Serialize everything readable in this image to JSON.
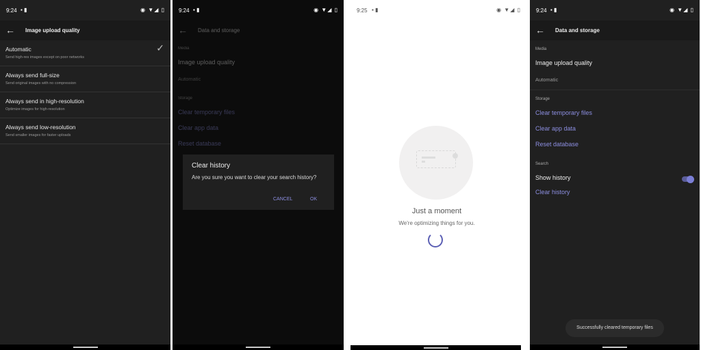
{
  "status": {
    "time1": "9:24",
    "time3": "9:25",
    "notif_icons": "image-icon, notification-icon",
    "sys_icons": "eye-icon wifi-icon signal-icon battery-icon"
  },
  "screen1": {
    "title": "Image upload quality",
    "options": [
      {
        "title": "Automatic",
        "subtitle": "Send high-res images except on poor networks",
        "selected": true
      },
      {
        "title": "Always send full-size",
        "subtitle": "Send original images with no compression",
        "selected": false
      },
      {
        "title": "Always send in high-resolution",
        "subtitle": "Optimize images for high-resolution",
        "selected": false
      },
      {
        "title": "Always send low-resolution",
        "subtitle": "Send smaller images for faster uploads",
        "selected": false
      }
    ]
  },
  "data_storage": {
    "title": "Data and storage",
    "media_section": "Media",
    "image_quality": "Image upload quality",
    "image_quality_value": "Automatic",
    "storage_section": "Storage",
    "clear_temp": "Clear temporary files",
    "clear_app": "Clear app data",
    "reset_db": "Reset database",
    "search_section": "Search",
    "show_history": "Show history",
    "show_history_on": true,
    "clear_history": "Clear history"
  },
  "dialog": {
    "title": "Clear history",
    "message": "Are you sure you want to clear your search history?",
    "cancel": "CANCEL",
    "ok": "OK"
  },
  "loading": {
    "title": "Just a moment",
    "subtitle": "We're optimizing things for you."
  },
  "toast": "Successfully cleared temporary files",
  "colors": {
    "accent": "#8c8ee0",
    "bg": "#202020"
  }
}
